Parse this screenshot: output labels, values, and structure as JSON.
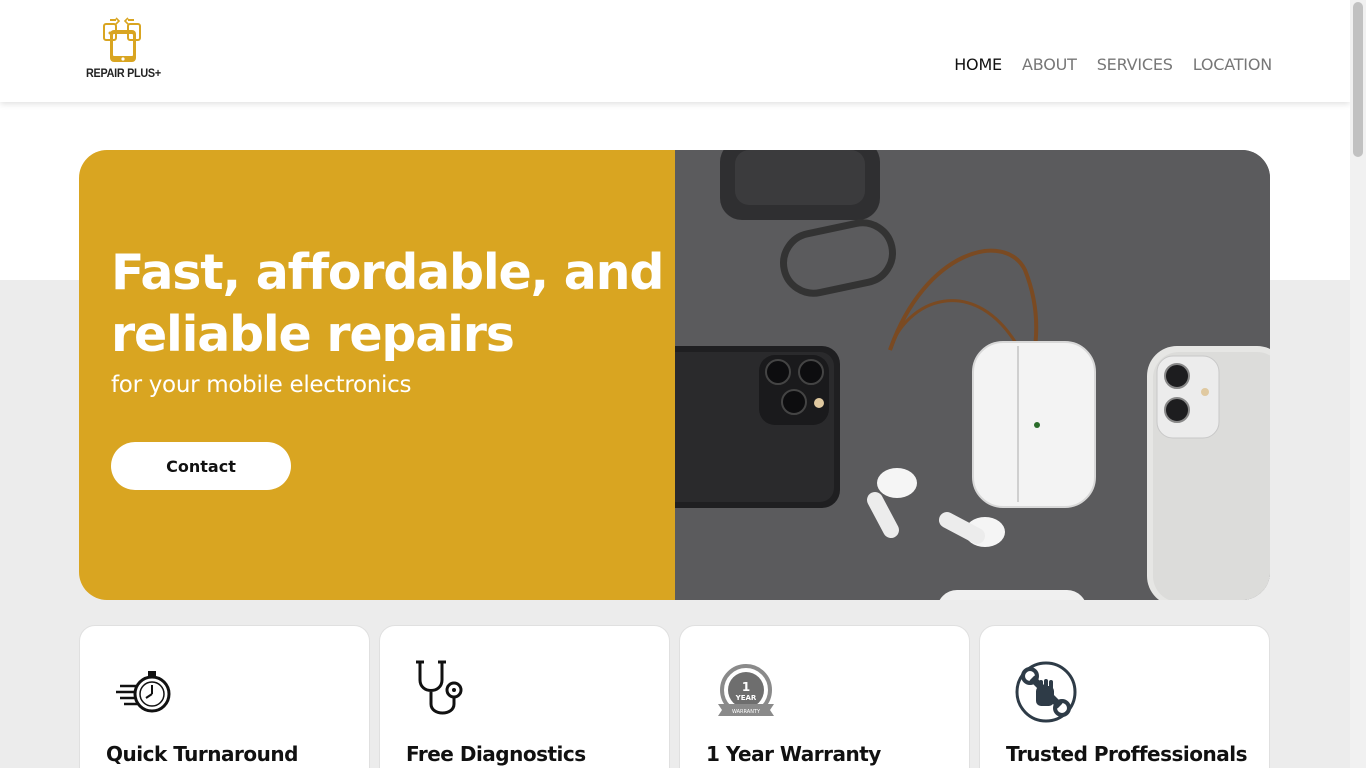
{
  "brand": {
    "name": "REPAIR PLUS+",
    "accent": "#d9a521"
  },
  "nav": {
    "items": [
      {
        "label": "HOME",
        "active": true
      },
      {
        "label": "ABOUT",
        "active": false
      },
      {
        "label": "SERVICES",
        "active": false
      },
      {
        "label": "LOCATION",
        "active": false
      }
    ]
  },
  "hero": {
    "title": "Fast, affordable, and reliable repairs",
    "subtitle": "for your mobile electronics",
    "cta_label": "Contact",
    "image": "photo of smartphones and wireless earbuds on grey surface"
  },
  "features": [
    {
      "title": "Quick Turnaround",
      "icon": "stopwatch-icon"
    },
    {
      "title": "Free Diagnostics",
      "icon": "stethoscope-icon"
    },
    {
      "title": "1 Year Warranty",
      "icon": "warranty-badge-icon",
      "badge_number": "1",
      "badge_word": "YEAR",
      "badge_ribbon": "WARRANTY"
    },
    {
      "title": "Trusted Proffessionals",
      "icon": "wrench-hand-icon"
    }
  ]
}
